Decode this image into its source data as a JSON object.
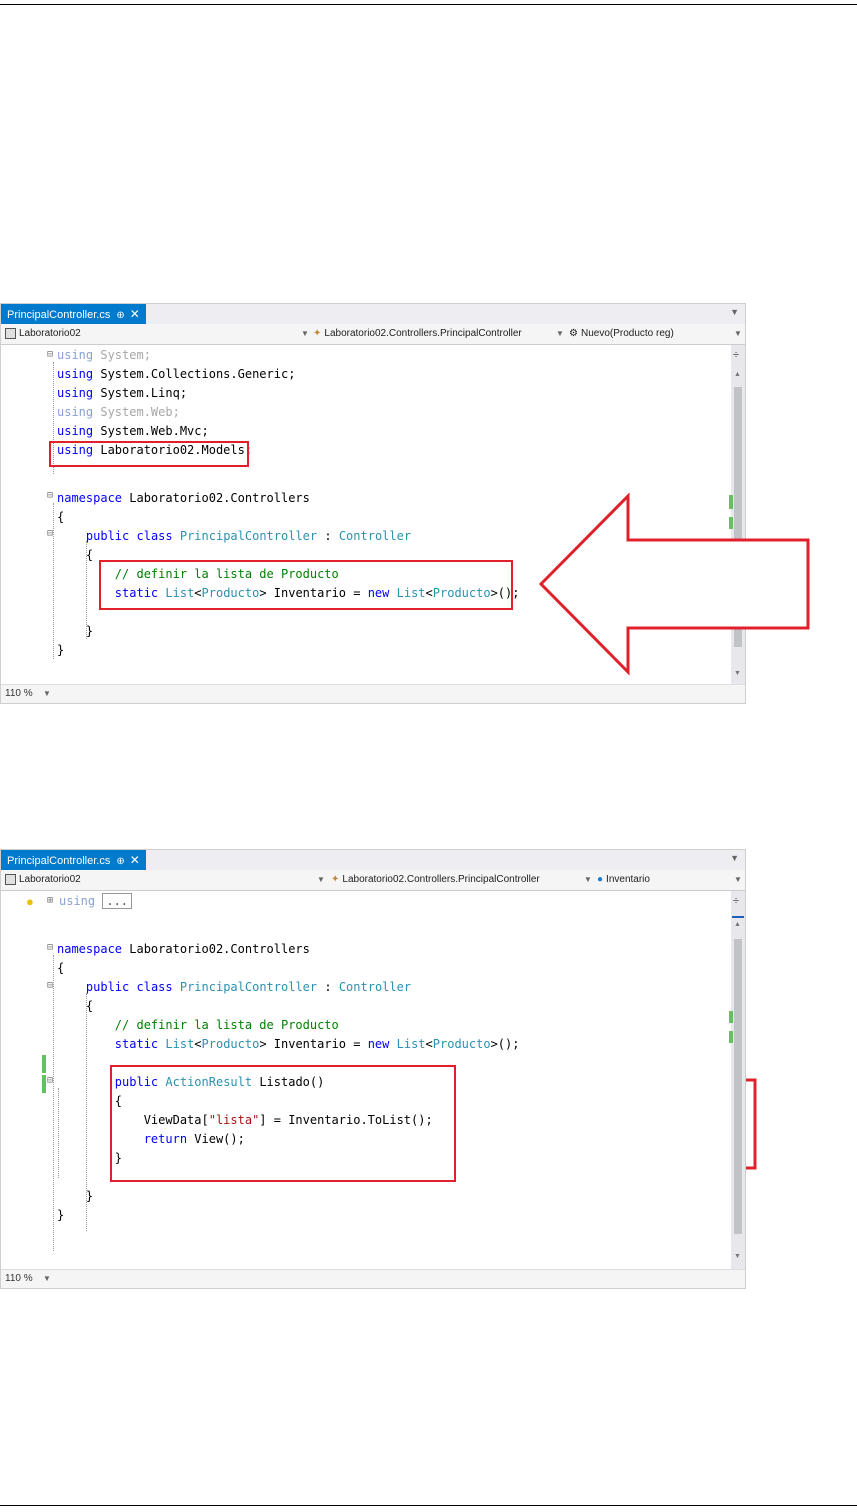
{
  "screenshot1": {
    "tab": {
      "title": "PrincipalController.cs",
      "pin": "⊕",
      "close": "✕"
    },
    "nav": {
      "project": "Laboratorio02",
      "class": "Laboratorio02.Controllers.PrincipalController",
      "member_icon": "⚙",
      "member": "Nuevo(Producto reg)"
    },
    "code": [
      "using System;",
      "using System.Collections.Generic;",
      "using System.Linq;",
      "using System.Web;",
      "using System.Web.Mvc;",
      "using Laboratorio02.Models;",
      "",
      "namespace Laboratorio02.Controllers",
      "{",
      "    public class PrincipalController : Controller",
      "    {",
      "        // definir la lista de Producto",
      "        static List<Producto> Inventario = new List<Producto>();",
      "    }",
      "}"
    ],
    "zoom": "110 %"
  },
  "screenshot2": {
    "tab": {
      "title": "PrincipalController.cs",
      "pin": "⊕",
      "close": "✕"
    },
    "nav": {
      "project": "Laboratorio02",
      "class": "Laboratorio02.Controllers.PrincipalController",
      "member": "Inventario"
    },
    "collapsed": {
      "keyword": "using",
      "ellipsis": "..."
    },
    "code": [
      "namespace Laboratorio02.Controllers",
      "{",
      "    public class PrincipalController : Controller",
      "    {",
      "        // definir la lista de Producto",
      "        static List<Producto> Inventario = new List<Producto>();",
      "",
      "        public ActionResult Listado()",
      "        {",
      "            ViewData[\"lista\"] = Inventario.ToList();",
      "            return View();",
      "        }",
      "    }",
      "}"
    ],
    "zoom": "110 %"
  },
  "colors": {
    "accent": "#007acc",
    "highlight": "#e0202a",
    "keyword": "#0000ff",
    "type": "#2b91af",
    "comment": "#008000",
    "string": "#a31515"
  },
  "icons": [
    "file-icon",
    "class-icon",
    "method-icon",
    "field-icon",
    "lightbulb-icon",
    "arrow-icon"
  ]
}
